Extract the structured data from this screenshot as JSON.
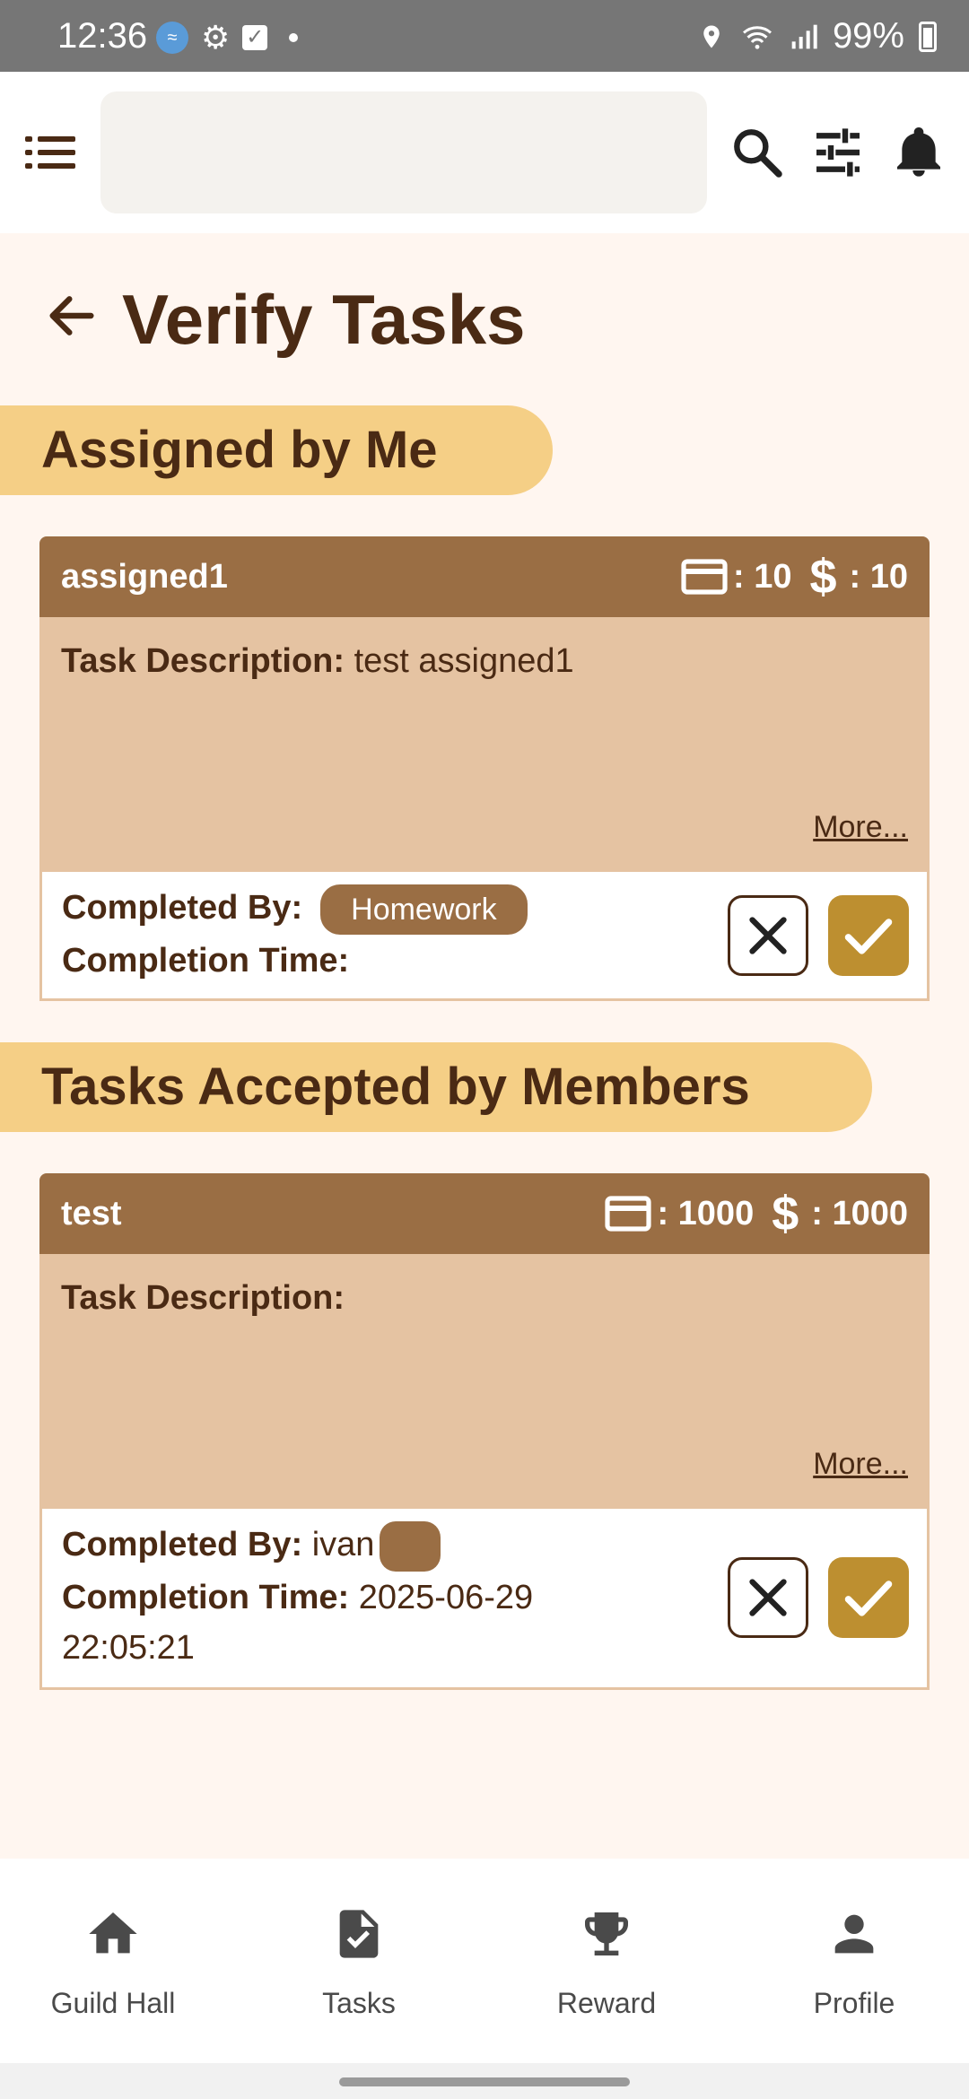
{
  "status_bar": {
    "time": "12:36",
    "battery": "99%",
    "icons": [
      "app-notification-icon",
      "settings-icon",
      "checkbox-icon",
      "dot-icon",
      "location-icon",
      "wifi-icon",
      "signal-icon",
      "battery-charging-icon"
    ]
  },
  "app_bar": {
    "search_value": "",
    "icons": [
      "menu-icon",
      "search-icon",
      "tune-icon",
      "bell-icon"
    ]
  },
  "page": {
    "title": "Verify Tasks"
  },
  "sections": [
    {
      "heading": "Assigned by Me",
      "task": {
        "name": "assigned1",
        "card_value": ": 10",
        "dollar_symbol": "$",
        "dollar_value": ": 10",
        "description_label": "Task Description:",
        "description": " test assigned1",
        "more": "More...",
        "completed_by_label": "Completed By:",
        "completed_by": "",
        "completed_by_chip": "Homework",
        "completion_time_label": "Completion Time:",
        "completion_time": ""
      }
    },
    {
      "heading": "Tasks Accepted by Members",
      "task": {
        "name": "test",
        "card_value": ": 1000",
        "dollar_symbol": "$",
        "dollar_value": ": 1000",
        "description_label": "Task Description:",
        "description": "",
        "more": "More...",
        "completed_by_label": "Completed By:",
        "completed_by": " ivan",
        "completed_by_chip": "",
        "completion_time_label": "Completion Time:",
        "completion_time": " 2025-06-29",
        "completion_time_line2": "22:05:21"
      }
    }
  ],
  "bottom_nav": [
    {
      "label": "Guild Hall",
      "icon": "home-icon"
    },
    {
      "label": "Tasks",
      "icon": "task-document-icon"
    },
    {
      "label": "Reward",
      "icon": "trophy-icon"
    },
    {
      "label": "Profile",
      "icon": "person-icon"
    }
  ],
  "colors": {
    "background": "#fff6f0",
    "primary_brown": "#9a6e44",
    "card_body": "#e5c3a2",
    "section_pill": "#f5cf86",
    "approve": "#bd8f30",
    "text": "#4a2a14"
  }
}
